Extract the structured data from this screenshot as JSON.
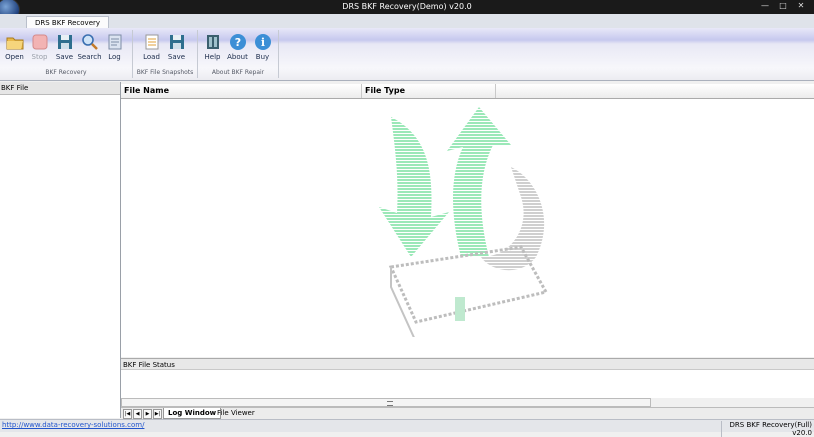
{
  "window": {
    "title": "DRS BKF Recovery(Demo) v20.0"
  },
  "ribbon": {
    "tab_label": "DRS BKF Recovery",
    "groups": [
      {
        "caption": "BKF Recovery",
        "buttons": [
          "Open",
          "Stop",
          "Save",
          "Search",
          "Log"
        ]
      },
      {
        "caption": "BKF File Snapshots",
        "buttons": [
          "Load",
          "Save"
        ]
      },
      {
        "caption": "About BKF Repair",
        "buttons": [
          "Help",
          "About",
          "Buy"
        ]
      }
    ]
  },
  "left_panel": {
    "header": "BKF File"
  },
  "file_list": {
    "columns": [
      "File Name",
      "File Type"
    ]
  },
  "status_panel": {
    "header": "BKF File Status"
  },
  "bottom_tabs": [
    "Log Window",
    "File Viewer"
  ],
  "statusbar": {
    "link": "http://www.data-recovery-solutions.com/",
    "right_text": "DRS BKF Recovery(Full) v20.0"
  },
  "icons": [
    "app-icon",
    "folder-open-icon",
    "stop-icon",
    "floppy-save-icon",
    "magnifier-icon",
    "log-icon",
    "load-icon",
    "floppy-save-icon",
    "help-icon",
    "about-icon",
    "info-icon"
  ],
  "colors": {
    "accent_green": "#9be8b8",
    "link": "#2255cc"
  }
}
